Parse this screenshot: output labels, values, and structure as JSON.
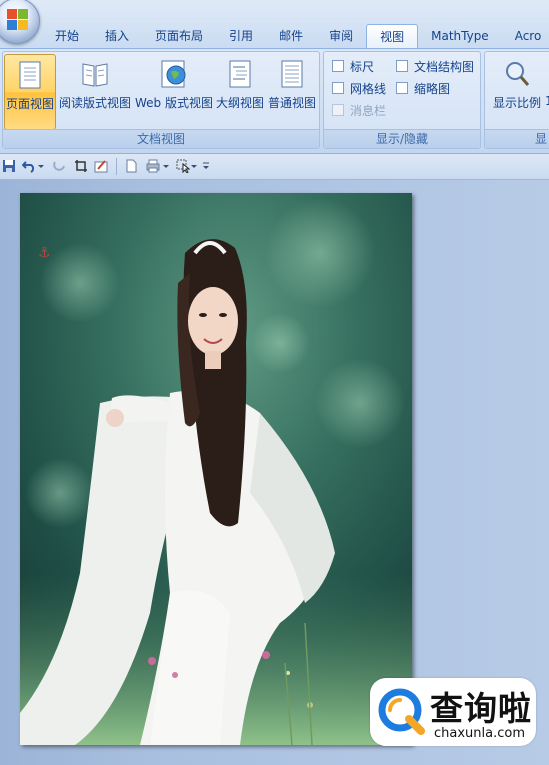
{
  "tabs": [
    "开始",
    "插入",
    "页面布局",
    "引用",
    "邮件",
    "审阅",
    "视图",
    "MathType",
    "Acro"
  ],
  "active_tab": "视图",
  "ribbon": {
    "document_views": {
      "group_label": "文档视图",
      "buttons": [
        "页面视图",
        "阅读版式视图",
        "Web 版式视图",
        "大纲视图",
        "普通视图"
      ],
      "active_button": "页面视图"
    },
    "show_hide": {
      "group_label": "显示/隐藏",
      "ruler": "标尺",
      "gridlines": "网格线",
      "message_bar": "消息栏",
      "document_map": "文档结构图",
      "thumbnails": "缩略图"
    },
    "zoom": {
      "group_label": "显",
      "button": "显示比例",
      "next_button": "1"
    }
  },
  "watermark": {
    "title": "查询啦",
    "url": "chaxunla.com"
  },
  "colors": {
    "ribbon_text": "#15428b",
    "active_button": "#ffd466",
    "doc_background": "#a9c0e0",
    "watermark_blue": "#1e7be0",
    "watermark_orange": "#f5a623"
  }
}
